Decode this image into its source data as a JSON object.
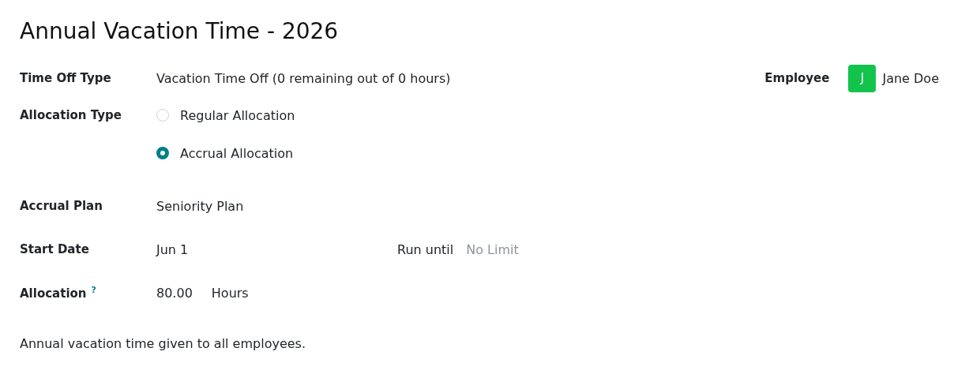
{
  "title": "Annual Vacation Time - 2026",
  "time_off_type": {
    "label": "Time Off Type",
    "value": "Vacation Time Off (0 remaining out of 0 hours)"
  },
  "employee": {
    "label": "Employee",
    "initial": "J",
    "name": "Jane Doe"
  },
  "allocation_type": {
    "label": "Allocation Type",
    "options": [
      {
        "label": "Regular Allocation",
        "selected": false
      },
      {
        "label": "Accrual Allocation",
        "selected": true
      }
    ]
  },
  "accrual_plan": {
    "label": "Accrual Plan",
    "value": "Seniority Plan"
  },
  "start_date": {
    "label": "Start Date",
    "value": "Jun 1"
  },
  "run_until": {
    "label": "Run until",
    "placeholder": "No Limit"
  },
  "allocation": {
    "label": "Allocation",
    "help": "?",
    "value": "80.00",
    "unit": "Hours"
  },
  "description": "Annual vacation time given to all employees."
}
